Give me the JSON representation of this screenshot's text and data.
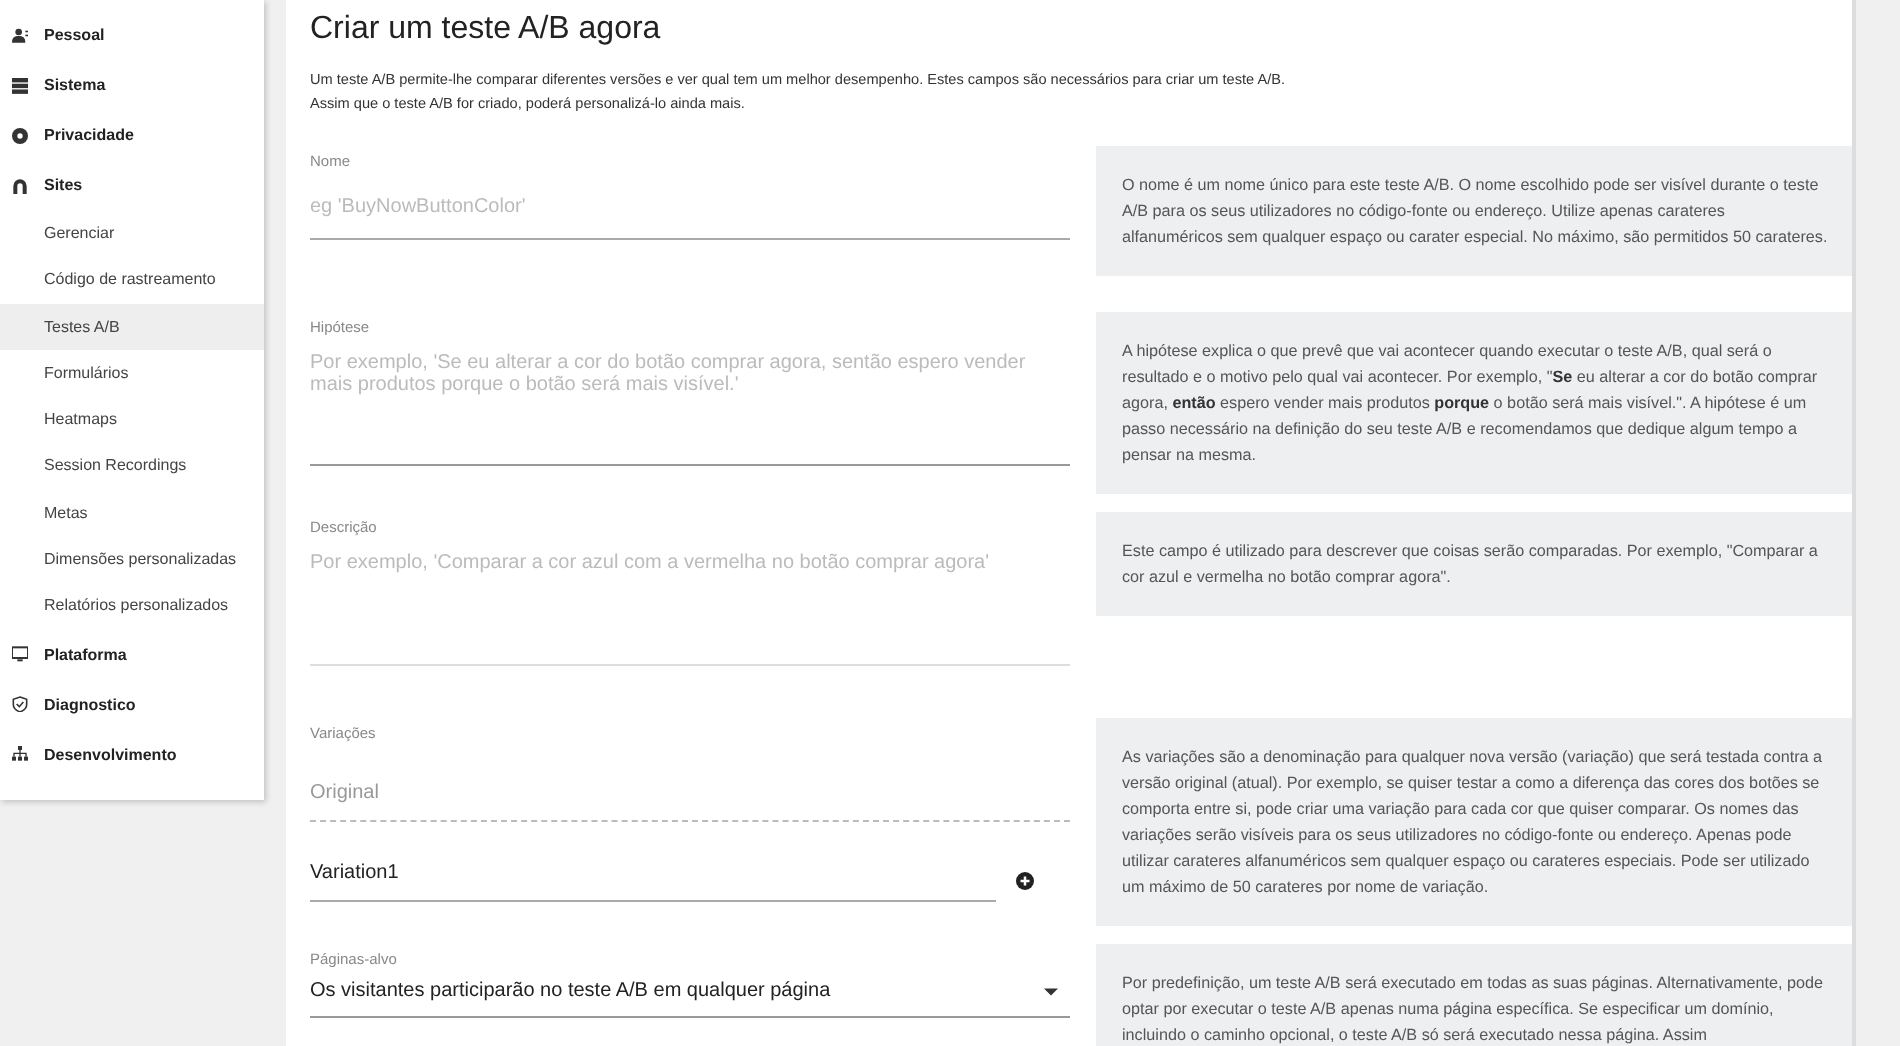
{
  "sidebar": {
    "items": [
      {
        "label": "Pessoal",
        "selected": false
      },
      {
        "label": "Sistema",
        "selected": false
      },
      {
        "label": "Privacidade",
        "selected": false
      },
      {
        "label": "Sites",
        "selected": false,
        "children": [
          {
            "label": "Gerenciar",
            "selected": false
          },
          {
            "label": "Código de rastreamento",
            "selected": false
          },
          {
            "label": "Testes A/B",
            "selected": true
          },
          {
            "label": "Formulários",
            "selected": false
          },
          {
            "label": "Heatmaps",
            "selected": false
          },
          {
            "label": "Session Recordings",
            "selected": false
          },
          {
            "label": "Metas",
            "selected": false
          },
          {
            "label": "Dimensões personalizadas",
            "selected": false
          },
          {
            "label": "Relatórios personalizados",
            "selected": false
          }
        ]
      },
      {
        "label": "Plataforma",
        "selected": false
      },
      {
        "label": "Diagnostico",
        "selected": false
      },
      {
        "label": "Desenvolvimento",
        "selected": false
      }
    ]
  },
  "page": {
    "title": "Criar um teste A/B agora",
    "intro": [
      "Um teste A/B permite-lhe comparar diferentes versões e ver qual tem um melhor desempenho. Estes campos são necessários para criar um teste A/B.",
      "Assim que o teste A/B for criado, poderá personalizá-lo ainda mais."
    ]
  },
  "fields": [
    {
      "kind": "text",
      "label": "Nome",
      "placeholder": "eg 'BuyNowButtonColor'",
      "help": "O nome é um nome único para este teste A/B. O nome escolhido pode ser visível durante o teste A/B para os seus utilizadores no código-fonte ou endereço. Utilize apenas carateres alfanuméricos sem qualquer espaço ou carater especial. No máximo, são permitidos 50 carateres."
    },
    {
      "kind": "textarea",
      "label": "Hipótese",
      "placeholder": "Por exemplo, 'Se eu alterar a cor do botão comprar agora, sentão espero vender mais produtos porque o botão será mais visível.'",
      "help": "A hipótese explica o que prevê que vai acontecer quando executar o teste A/B, qual será o resultado e o motivo pelo qual vai acontecer. Por exemplo, \"**Se** eu alterar a cor do botão comprar agora, **então** espero vender mais produtos **porque** o botão será mais visível.\". A hipótese é um passo necessário na definição do seu teste A/B e recomendamos que dedique algum tempo a pensar na mesma."
    },
    {
      "kind": "textarea",
      "label": "Descrição",
      "placeholder": "Por exemplo, 'Comparar a cor azul com a vermelha no botão comprar agora'",
      "help": "Este campo é utilizado para descrever que coisas serão comparadas. Por exemplo, \"Comparar a cor azul e vermelha no botão comprar agora\"."
    },
    {
      "kind": "variations",
      "label": "Variações",
      "items": [
        {
          "value": "Original",
          "disabled": true
        },
        {
          "value": "Variation1",
          "disabled": false
        }
      ],
      "help": "As variações são a denominação para qualquer nova versão (variação) que será testada contra a versão original (atual). Por exemplo, se quiser testar a como a diferença das cores dos botões se comporta entre si, pode criar uma variação para cada cor que quiser comparar. Os nomes das variações serão visíveis para os seus utilizadores no código-fonte ou endereço. Apenas pode utilizar carateres alfanuméricos sem qualquer espaço ou carateres especiais. Pode ser utilizado um máximo de 50 carateres por nome de variação."
    },
    {
      "kind": "select",
      "label": "Páginas-alvo",
      "value": "Os visitantes participarão no teste A/B em qualquer página",
      "help": "Por predefinição, um teste A/B será executado em todas as suas páginas. Alternativamente, pode optar por executar o teste A/B apenas numa página específica. Se especificar um domínio, incluindo o caminho opcional, o teste A/B só será executado nessa página. Assim"
    }
  ]
}
